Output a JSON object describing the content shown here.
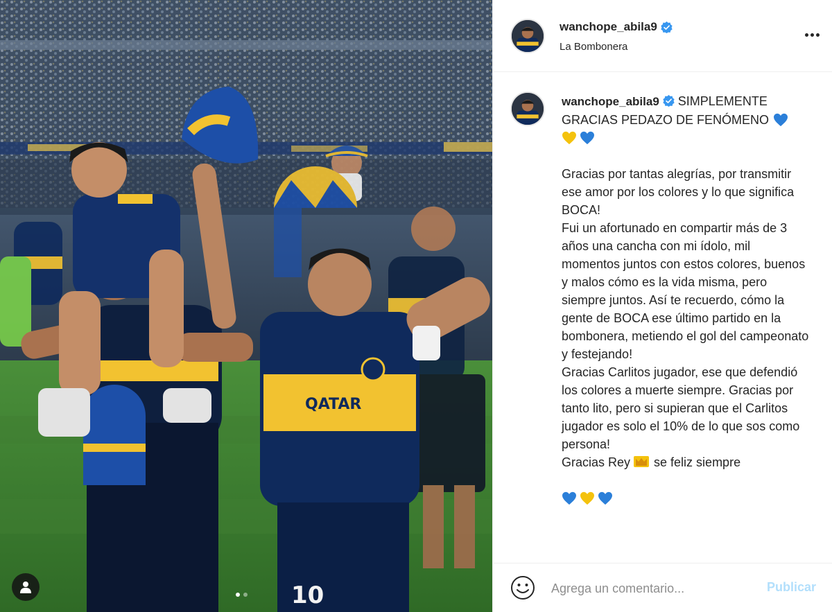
{
  "post": {
    "username": "wanchope_abila9",
    "location": "La Bombonera",
    "verified": true,
    "carousel": {
      "total_images": 2,
      "current_index": 1
    }
  },
  "caption": {
    "username": "wanchope_abila9",
    "headline": "SIMPLEMENTE GRACIAS PEDAZO DE FENÓMENO",
    "paragraph_1": "Gracias por tantas alegrías, por transmitir ese amor por los colores y lo que significa BOCA!",
    "paragraph_2": "Fui un afortunado en compartir más de 3 años una cancha con mi ídolo, mil momentos juntos con estos colores, buenos y malos cómo es la vida misma, pero siempre juntos. Así te recuerdo, cómo la gente de BOCA ese último partido en la bombonera, metiendo el gol del campeonato y festejando!",
    "paragraph_3": "Gracias Carlitos jugador, ese que defendió los colores a muerte siempre. Gracias por tanto lito, pero si supieran que el Carlitos jugador es solo el 10% de lo que sos como persona!",
    "closing_before": "Gracias Rey",
    "closing_after": "se feliz siempre",
    "emoji": [
      "blue-heart",
      "yellow-heart",
      "blue-heart",
      "crown",
      "blue-heart",
      "yellow-heart",
      "blue-heart"
    ]
  },
  "comment": {
    "placeholder": "Agrega un comentario...",
    "publish_label": "Publicar"
  },
  "colors": {
    "verified_blue": "#3897f0",
    "publish_disabled": "#b2dffc",
    "heart_blue": "#2b7fd9",
    "heart_yellow": "#f4c20d",
    "boca_blue": "#0f2a5c",
    "boca_gold": "#f2c230"
  }
}
